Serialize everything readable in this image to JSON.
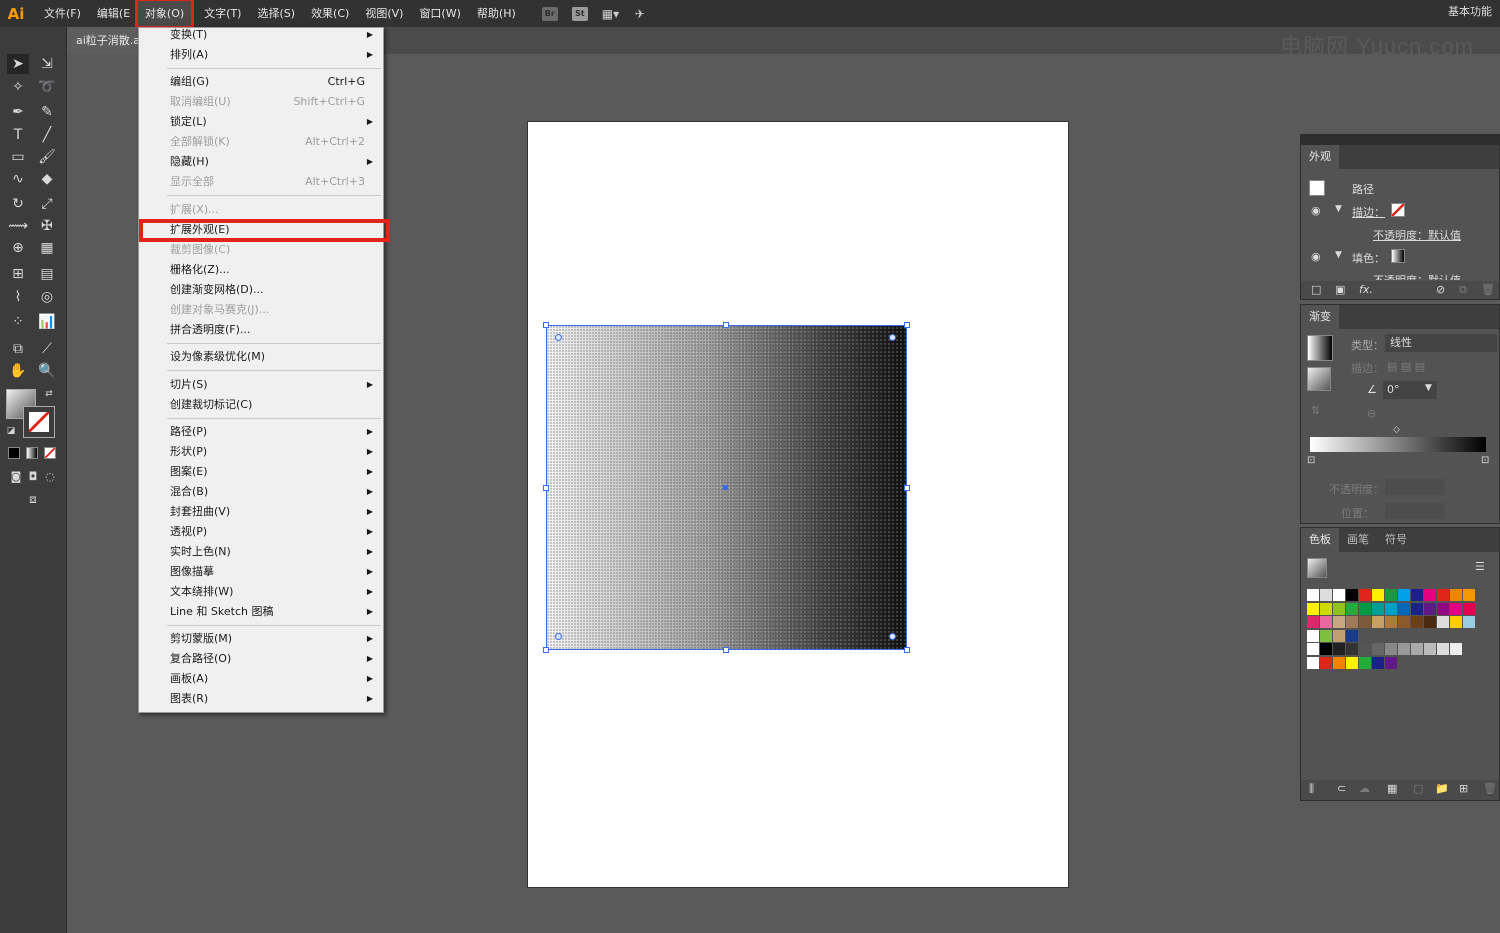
{
  "app": {
    "logo": "Ai",
    "workspace": "基本功能",
    "watermark": "电脑网 Yuucn.com"
  },
  "menubar": [
    "文件(F)",
    "编辑(E",
    "对象(O)",
    "文字(T)",
    "选择(S)",
    "效果(C)",
    "视图(V)",
    "窗口(W)",
    "帮助(H)"
  ],
  "menubar_icons": [
    "Br",
    "St"
  ],
  "doc_tab": "ai粒子消散.a",
  "object_menu": {
    "items": [
      {
        "label": "变换(T)",
        "submenu": true
      },
      {
        "label": "排列(A)",
        "submenu": true
      },
      {
        "label": "编组(G)",
        "shortcut": "Ctrl+G"
      },
      {
        "label": "取消编组(U)",
        "shortcut": "Shift+Ctrl+G",
        "disabled": true
      },
      {
        "label": "锁定(L)",
        "submenu": true
      },
      {
        "label": "全部解锁(K)",
        "shortcut": "Alt+Ctrl+2",
        "disabled": true
      },
      {
        "label": "隐藏(H)",
        "submenu": true
      },
      {
        "label": "显示全部",
        "shortcut": "Alt+Ctrl+3",
        "disabled": true
      },
      {
        "label": "扩展(X)...",
        "disabled": true
      },
      {
        "label": "扩展外观(E)",
        "highlighted": true
      },
      {
        "label": "裁剪图像(C)",
        "disabled": true
      },
      {
        "label": "栅格化(Z)..."
      },
      {
        "label": "创建渐变网格(D)..."
      },
      {
        "label": "创建对象马赛克(J)...",
        "disabled": true
      },
      {
        "label": "拼合透明度(F)..."
      },
      {
        "label": "设为像素级优化(M)"
      },
      {
        "label": "切片(S)",
        "submenu": true
      },
      {
        "label": "创建裁切标记(C)"
      },
      {
        "label": "路径(P)",
        "submenu": true
      },
      {
        "label": "形状(P)",
        "submenu": true
      },
      {
        "label": "图案(E)",
        "submenu": true
      },
      {
        "label": "混合(B)",
        "submenu": true
      },
      {
        "label": "封套扭曲(V)",
        "submenu": true
      },
      {
        "label": "透视(P)",
        "submenu": true
      },
      {
        "label": "实时上色(N)",
        "submenu": true
      },
      {
        "label": "图像描摹",
        "submenu": true
      },
      {
        "label": "文本绕排(W)",
        "submenu": true
      },
      {
        "label": "Line 和 Sketch 图稿",
        "submenu": true
      },
      {
        "label": "剪切蒙版(M)",
        "submenu": true
      },
      {
        "label": "复合路径(O)",
        "submenu": true
      },
      {
        "label": "画板(A)",
        "submenu": true
      },
      {
        "label": "图表(R)",
        "submenu": true
      }
    ]
  },
  "appearance_panel": {
    "tab": "外观",
    "object": "路径",
    "stroke_label": "描边：",
    "opacity1": "不透明度：默认值",
    "fill_label": "填色：",
    "opacity2": "不透明度：默认值"
  },
  "gradient_panel": {
    "tab": "渐变",
    "type_label": "类型：",
    "type_value": "线性",
    "stroke_label": "描边：",
    "angle": "0°",
    "opacity_label": "不透明度：",
    "position_label": "位置："
  },
  "swatches_panel": {
    "tabs": [
      "色板",
      "画笔",
      "符号"
    ]
  },
  "colors": {
    "accent_red": "#e0251b",
    "selection_blue": "#3b6cf0",
    "logo_orange": "#ff9a00"
  }
}
